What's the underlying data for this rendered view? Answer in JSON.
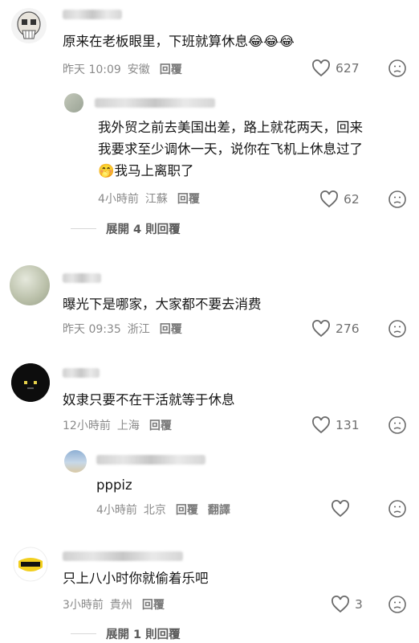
{
  "comments": [
    {
      "text": "原来在老板眼里，下班就算休息",
      "emoji": "😂😂😂",
      "time": "昨天 10:09",
      "location": "安徽",
      "reply_label": "回覆",
      "likes": "627",
      "reply": {
        "text_line1": "我外贸之前去美国出差，路上就花两天，回来",
        "text_line2": "我要求至少调休一天，说你在飞机上休息过了",
        "text_line3": "我马上离职了",
        "emoji": "🤭",
        "time": "4小時前",
        "location": "江蘇",
        "reply_label": "回覆",
        "likes": "62"
      },
      "expand_label": "展開 4 則回覆"
    },
    {
      "text": "曝光下是哪家，大家都不要去消费",
      "time": "昨天 09:35",
      "location": "浙江",
      "reply_label": "回覆",
      "likes": "276"
    },
    {
      "text": "奴隶只要不在干活就等于休息",
      "time": "12小時前",
      "location": "上海",
      "reply_label": "回覆",
      "likes": "131",
      "reply": {
        "text": "pppiz",
        "time": "4小時前",
        "location": "北京",
        "reply_label": "回覆",
        "translate_label": "翻譯",
        "likes": ""
      }
    },
    {
      "text": "只上八小时你就偷着乐吧",
      "time": "3小時前",
      "location": "貴州",
      "reply_label": "回覆",
      "likes": "3",
      "expand_label": "展開 1 則回覆"
    }
  ]
}
